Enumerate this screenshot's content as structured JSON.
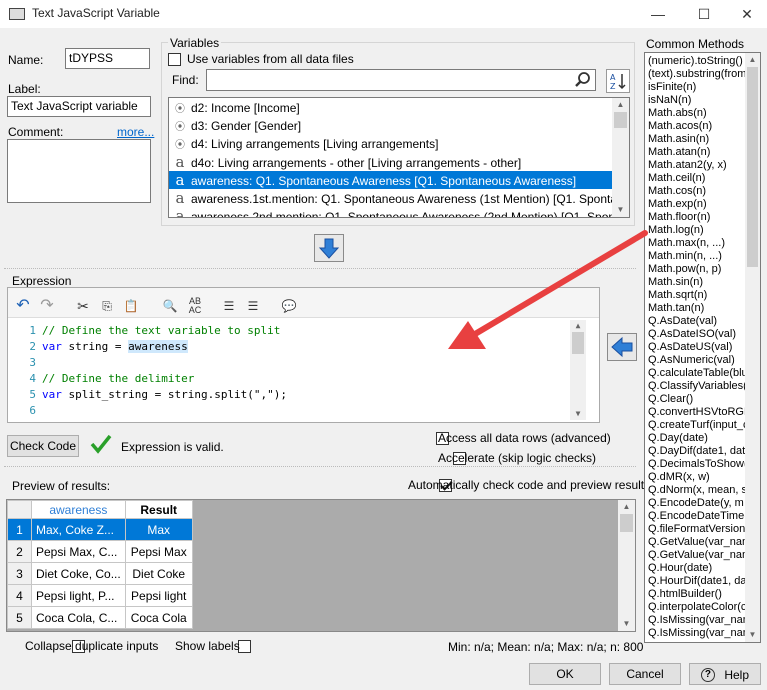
{
  "window": {
    "title": "Text JavaScript Variable",
    "minimize": "—",
    "maximize": "☐",
    "close": "✕"
  },
  "name": {
    "label": "Name:",
    "value": "tDYPSS"
  },
  "label": {
    "label": "Label:",
    "value": "Text JavaScript variable"
  },
  "comment": {
    "label": "Comment:",
    "more": "more..."
  },
  "variables": {
    "group_label": "Variables",
    "use_all_label": "Use variables from all data files",
    "find_label": "Find:",
    "items": [
      {
        "icon": "⦿",
        "text": "d2: Income [Income]",
        "selected": false
      },
      {
        "icon": "⦿",
        "text": "d3: Gender [Gender]",
        "selected": false
      },
      {
        "icon": "⦿",
        "text": "d4: Living arrangements [Living arrangements]",
        "selected": false
      },
      {
        "icon": "a",
        "text": "d4o: Living arrangements - other [Living arrangements - other]",
        "selected": false
      },
      {
        "icon": "a",
        "text": "awareness: Q1. Spontaneous Awareness [Q1. Spontaneous Awareness]",
        "selected": true
      },
      {
        "icon": "a",
        "text": "awareness.1st.mention: Q1. Spontaneous Awareness (1st Mention) [Q1. Spontaneous ...",
        "selected": false
      },
      {
        "icon": "a",
        "text": "awareness.2nd.mention: Q1. Spontaneous Awareness (2nd Mention) [Q1. Spontaneou...",
        "selected": false
      }
    ]
  },
  "expression": {
    "label": "Expression",
    "lines": [
      {
        "num": "1",
        "parts": [
          [
            "cm",
            "// Define the text variable to split"
          ]
        ]
      },
      {
        "num": "2",
        "parts": [
          [
            "kw",
            "var"
          ],
          [
            "",
            " string = "
          ],
          [
            "hl",
            "awareness"
          ]
        ]
      },
      {
        "num": "3",
        "parts": []
      },
      {
        "num": "4",
        "parts": [
          [
            "cm",
            "// Define the delimiter"
          ]
        ]
      },
      {
        "num": "5",
        "parts": [
          [
            "kw",
            "var"
          ],
          [
            "",
            " split_string = string.split(\",\");"
          ]
        ]
      },
      {
        "num": "6",
        "parts": []
      }
    ]
  },
  "check": {
    "button": "Check Code",
    "status": "Expression is valid."
  },
  "options": {
    "access_all": "Access all data rows (advanced)",
    "accelerate": "Accelerate (skip logic checks)",
    "auto_check": "Automatically check code and preview results"
  },
  "preview": {
    "label": "Preview of results:",
    "col1": "awareness",
    "col2": "Result",
    "rows": [
      {
        "n": "1",
        "a": "Max, Coke Z...",
        "r": "Max"
      },
      {
        "n": "2",
        "a": "Pepsi Max, C...",
        "r": "Pepsi Max"
      },
      {
        "n": "3",
        "a": "Diet Coke, Co...",
        "r": "Diet Coke"
      },
      {
        "n": "4",
        "a": "Pepsi light, P...",
        "r": "Pepsi light"
      },
      {
        "n": "5",
        "a": "Coca Cola, C...",
        "r": "Coca Cola"
      }
    ]
  },
  "bottom": {
    "collapse": "Collapse duplicate inputs",
    "show_labels": "Show labels",
    "stats": "Min: n/a; Mean: n/a; Max: n/a; n: 800",
    "ok": "OK",
    "cancel": "Cancel",
    "help": "Help"
  },
  "methods": {
    "label": "Common Methods",
    "items": [
      "(numeric).toString()",
      "(text).substring(from,",
      "isFinite(n)",
      "isNaN(n)",
      "Math.abs(n)",
      "Math.acos(n)",
      "Math.asin(n)",
      "Math.atan(n)",
      "Math.atan2(y, x)",
      "Math.ceil(n)",
      "Math.cos(n)",
      "Math.exp(n)",
      "Math.floor(n)",
      "Math.log(n)",
      "Math.max(n, ...)",
      "Math.min(n, ...)",
      "Math.pow(n, p)",
      "Math.sin(n)",
      "Math.sqrt(n)",
      "Math.tan(n)",
      "Q.AsDate(val)",
      "Q.AsDateISO(val)",
      "Q.AsDateUS(val)",
      "Q.AsNumeric(val)",
      "Q.calculateTable(blu",
      "Q.ClassifyVariables(v",
      "Q.Clear()",
      "Q.convertHSVtoRGB",
      "Q.createTurf(input_c",
      "Q.Day(date)",
      "Q.DayDif(date1, date",
      "Q.DecimalsToShow(",
      "Q.dMR(x, w)",
      "Q.dNorm(x, mean, sd",
      "Q.EncodeDate(y, m",
      "Q.EncodeDateTime(",
      "Q.fileFormatVersion(",
      "Q.GetValue(var_nam",
      "Q.GetValue(var_nam",
      "Q.Hour(date)",
      "Q.HourDif(date1, dat",
      "Q.htmlBuilder()",
      "Q.interpolateColor(co",
      "Q.IsMissing(var_nam",
      "Q.IsMissing(var_nam"
    ]
  },
  "colors": {
    "accent": "#0078d7",
    "arrow": "#e84040"
  }
}
